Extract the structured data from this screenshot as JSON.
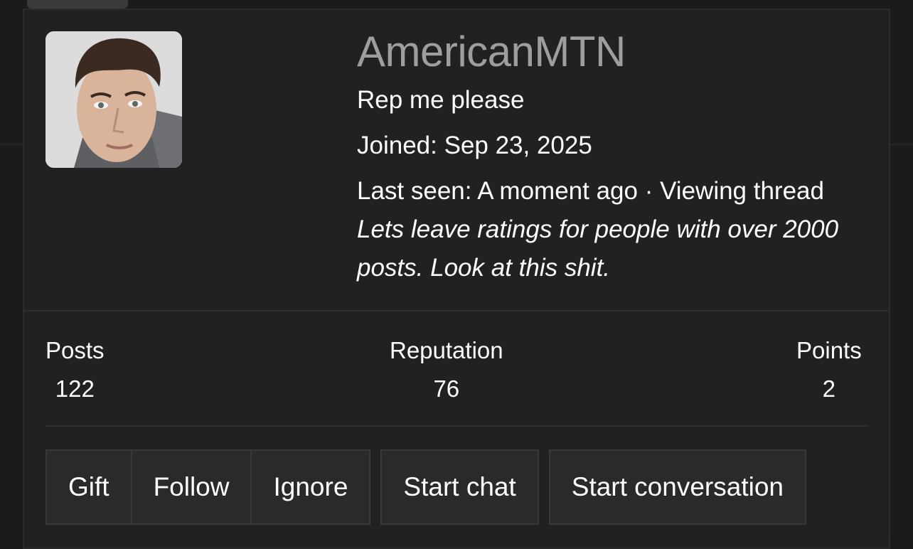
{
  "profile": {
    "username": "AmericanMTN",
    "tagline": "Rep me please",
    "joined": "Joined: Sep 23, 2025",
    "last_seen_prefix": "Last seen: A moment ago · Viewing thread",
    "last_seen_thread": "Lets leave ratings for people with over 2000 posts. Look at this shit."
  },
  "stats": {
    "posts_label": "Posts",
    "posts_value": "122",
    "reputation_label": "Reputation",
    "reputation_value": "76",
    "points_label": "Points",
    "points_value": "2"
  },
  "actions": {
    "gift": "Gift",
    "follow": "Follow",
    "ignore": "Ignore",
    "start_chat": "Start chat",
    "start_conversation": "Start conversation"
  },
  "colors": {
    "background": "#1b1b1b",
    "card": "#212121",
    "username": "#9e9e9e",
    "text": "#ffffff",
    "button": "#2a2a2a"
  }
}
